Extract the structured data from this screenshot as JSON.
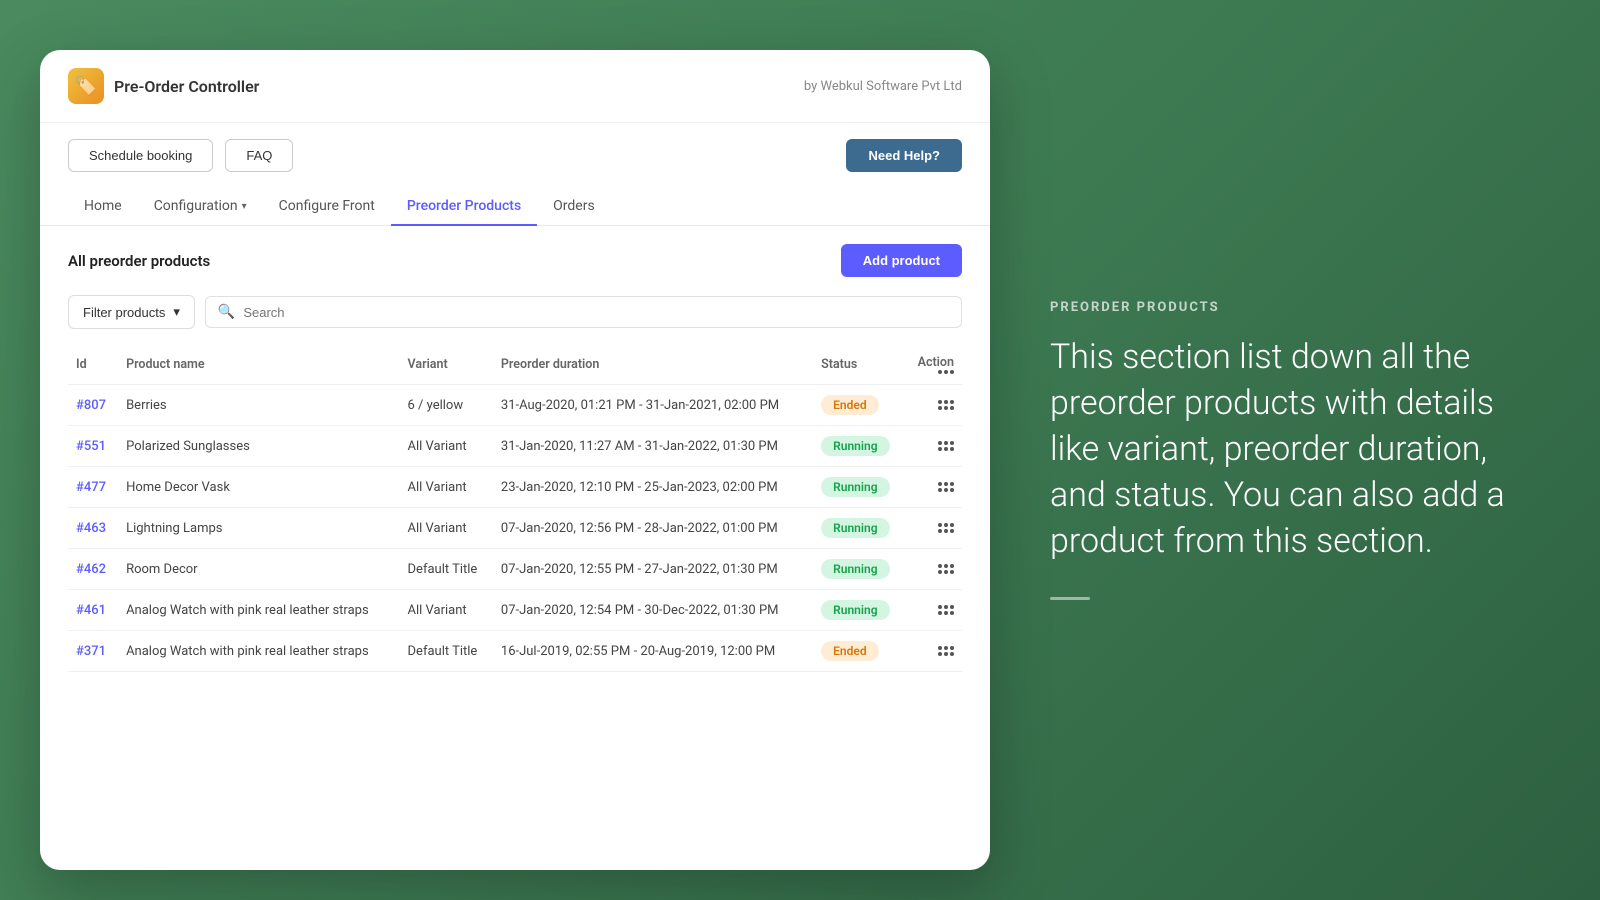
{
  "brand": {
    "name": "Pre-Order Controller",
    "by": "by Webkul Software Pvt Ltd",
    "icon": "🏷️"
  },
  "buttons": {
    "schedule_booking": "Schedule booking",
    "faq": "FAQ",
    "need_help": "Need Help?",
    "add_product": "Add product",
    "filter_products": "Filter products"
  },
  "nav": {
    "tabs": [
      {
        "label": "Home",
        "active": false
      },
      {
        "label": "Configuration",
        "active": false,
        "has_dropdown": true
      },
      {
        "label": "Configure Front",
        "active": false
      },
      {
        "label": "Preorder Products",
        "active": true
      },
      {
        "label": "Orders",
        "active": false
      }
    ]
  },
  "page": {
    "title": "All preorder products"
  },
  "search": {
    "placeholder": "Search"
  },
  "table": {
    "columns": [
      "Id",
      "Product name",
      "Variant",
      "Preorder duration",
      "Status",
      "Action"
    ],
    "rows": [
      {
        "id": "#807",
        "product_name": "Berries",
        "variant": "6 / yellow",
        "preorder_duration": "31-Aug-2020, 01:21 PM - 31-Jan-2021, 02:00 PM",
        "status": "Ended",
        "status_type": "ended"
      },
      {
        "id": "#551",
        "product_name": "Polarized Sunglasses",
        "variant": "All Variant",
        "preorder_duration": "31-Jan-2020, 11:27 AM - 31-Jan-2022, 01:30 PM",
        "status": "Running",
        "status_type": "running"
      },
      {
        "id": "#477",
        "product_name": "Home Decor Vask",
        "variant": "All Variant",
        "preorder_duration": "23-Jan-2020, 12:10 PM - 25-Jan-2023, 02:00 PM",
        "status": "Running",
        "status_type": "running"
      },
      {
        "id": "#463",
        "product_name": "Lightning Lamps",
        "variant": "All Variant",
        "preorder_duration": "07-Jan-2020, 12:56 PM - 28-Jan-2022, 01:00 PM",
        "status": "Running",
        "status_type": "running"
      },
      {
        "id": "#462",
        "product_name": "Room Decor",
        "variant": "Default Title",
        "preorder_duration": "07-Jan-2020, 12:55 PM - 27-Jan-2022, 01:30 PM",
        "status": "Running",
        "status_type": "running"
      },
      {
        "id": "#461",
        "product_name": "Analog Watch with pink real leather straps",
        "variant": "All Variant",
        "preorder_duration": "07-Jan-2020, 12:54 PM - 30-Dec-2022, 01:30 PM",
        "status": "Running",
        "status_type": "running"
      },
      {
        "id": "#371",
        "product_name": "Analog Watch with pink real leather straps",
        "variant": "Default Title",
        "preorder_duration": "16-Jul-2019, 02:55 PM - 20-Aug-2019, 12:00 PM",
        "status": "Ended",
        "status_type": "ended"
      }
    ]
  },
  "right_panel": {
    "section_label": "PREORDER PRODUCTS",
    "description": "This section list down all the preorder products with details like variant, preorder duration, and status. You can also add a product from this section."
  }
}
